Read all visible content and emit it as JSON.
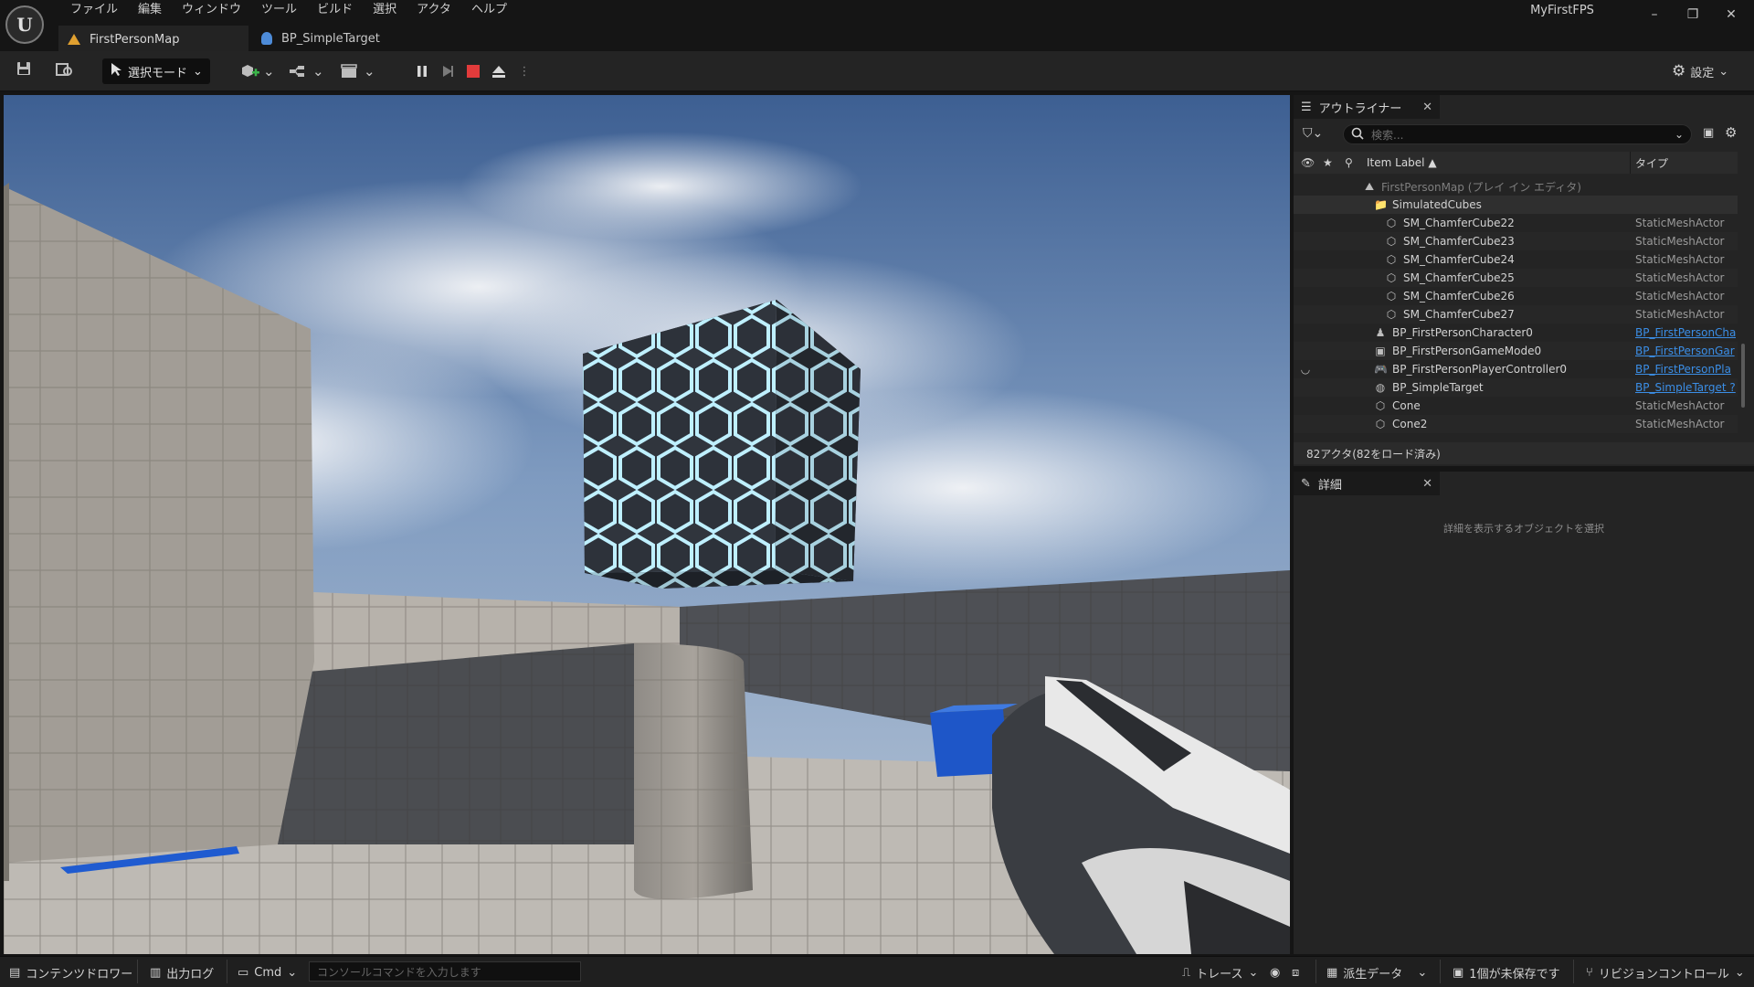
{
  "app": {
    "project_name": "MyFirstFPS",
    "menu": [
      "ファイル",
      "編集",
      "ウィンドウ",
      "ツール",
      "ビルド",
      "選択",
      "アクタ",
      "ヘルプ"
    ],
    "tabs": [
      {
        "label": "FirstPersonMap",
        "icon": "level-warning-icon",
        "active": true
      },
      {
        "label": "BP_SimpleTarget",
        "icon": "blueprint-icon",
        "active": false
      }
    ]
  },
  "toolbar": {
    "mode_label": "選択モード",
    "settings_label": "設定",
    "play_controls": [
      "pause-icon",
      "step-icon",
      "stop-icon",
      "eject-icon"
    ],
    "stop_color": "#e23b3b"
  },
  "outliner": {
    "title": "アウトライナー",
    "search_placeholder": "検索...",
    "columns": {
      "label": "Item Label ▲",
      "type": "タイプ"
    },
    "rows": [
      {
        "label": "FirstPersonMap (プレイ イン エディタ)",
        "type": "",
        "indent": 0,
        "icon": "level-icon",
        "dim": true
      },
      {
        "label": "SimulatedCubes",
        "type": "",
        "indent": 1,
        "icon": "folder-icon"
      },
      {
        "label": "SM_ChamferCube22",
        "type": "StaticMeshActor",
        "indent": 2,
        "icon": "static-mesh-icon"
      },
      {
        "label": "SM_ChamferCube23",
        "type": "StaticMeshActor",
        "indent": 2,
        "icon": "static-mesh-icon"
      },
      {
        "label": "SM_ChamferCube24",
        "type": "StaticMeshActor",
        "indent": 2,
        "icon": "static-mesh-icon"
      },
      {
        "label": "SM_ChamferCube25",
        "type": "StaticMeshActor",
        "indent": 2,
        "icon": "static-mesh-icon"
      },
      {
        "label": "SM_ChamferCube26",
        "type": "StaticMeshActor",
        "indent": 2,
        "icon": "static-mesh-icon"
      },
      {
        "label": "SM_ChamferCube27",
        "type": "StaticMeshActor",
        "indent": 2,
        "icon": "static-mesh-icon"
      },
      {
        "label": "BP_FirstPersonCharacter0",
        "type": "BP_FirstPersonCha",
        "indent": 1,
        "icon": "character-icon",
        "link": true
      },
      {
        "label": "BP_FirstPersonGameMode0",
        "type": "BP_FirstPersonGar",
        "indent": 1,
        "icon": "game-mode-icon",
        "link": true
      },
      {
        "label": "BP_FirstPersonPlayerController0",
        "type": "BP_FirstPersonPla",
        "indent": 1,
        "icon": "controller-icon",
        "link": true
      },
      {
        "label": "BP_SimpleTarget",
        "type": "BP_SimpleTarget ?",
        "indent": 1,
        "icon": "blueprint-actor-icon",
        "link": true
      },
      {
        "label": "Cone",
        "type": "StaticMeshActor",
        "indent": 1,
        "icon": "static-mesh-icon"
      },
      {
        "label": "Cone2",
        "type": "StaticMeshActor",
        "indent": 1,
        "icon": "static-mesh-icon"
      }
    ],
    "status": "82アクタ(82をロード済み)"
  },
  "details": {
    "title": "詳細",
    "hint": "詳細を表示するオブジェクトを選択"
  },
  "bottombar": {
    "content_drawer": "コンテンツドロワー",
    "output_log": "出力ログ",
    "cmd": "Cmd",
    "console_placeholder": "コンソールコマンドを入力します",
    "trace": "トレース",
    "derived_data": "派生データ",
    "unsaved": "1個が未保存です",
    "revision_control": "リビジョンコントロール"
  }
}
